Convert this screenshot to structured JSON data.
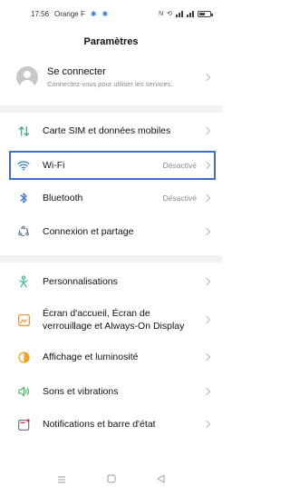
{
  "status_bar": {
    "time": "17:56",
    "carrier": "Orange F",
    "icons": [
      "settings-gear",
      "settings-gear",
      "nfc-icon",
      "vibrate-icon",
      "signal-icon",
      "battery-icon"
    ]
  },
  "title": "Paramètres",
  "account": {
    "title": "Se connecter",
    "subtitle": "Connectez-vous pour utiliser les services."
  },
  "items": [
    {
      "label": "Carte SIM et données mobiles",
      "value": "",
      "icon": "sim-data-icon"
    },
    {
      "label": "Wi-Fi",
      "value": "Désactivé",
      "icon": "wifi-icon"
    },
    {
      "label": "Bluetooth",
      "value": "Désactivé",
      "icon": "bluetooth-icon"
    },
    {
      "label": "Connexion et partage",
      "value": "",
      "icon": "connection-sharing-icon"
    },
    {
      "label": "Personnalisations",
      "value": "",
      "icon": "personalization-icon"
    },
    {
      "label": "Écran d'accueil, Écran de verrouillage et Always-On Display",
      "value": "",
      "icon": "home-screen-icon"
    },
    {
      "label": "Affichage et luminosité",
      "value": "",
      "icon": "display-brightness-icon"
    },
    {
      "label": "Sons et vibrations",
      "value": "",
      "icon": "sound-icon"
    },
    {
      "label": "Notifications et barre d'état",
      "value": "",
      "icon": "notification-icon"
    }
  ],
  "colors": {
    "accent": "#2f7bd6",
    "highlight": "#3d6ec9",
    "sim": "#3aa86b",
    "wifi": "#2f7bd6",
    "bluetooth": "#3c6fd6",
    "connection": "#5a6b8c",
    "personalization": "#2fb583",
    "home_screen": "#f08a2b",
    "display": "#f0a11e",
    "sound": "#2fb04a",
    "notification": "#e0334a"
  }
}
